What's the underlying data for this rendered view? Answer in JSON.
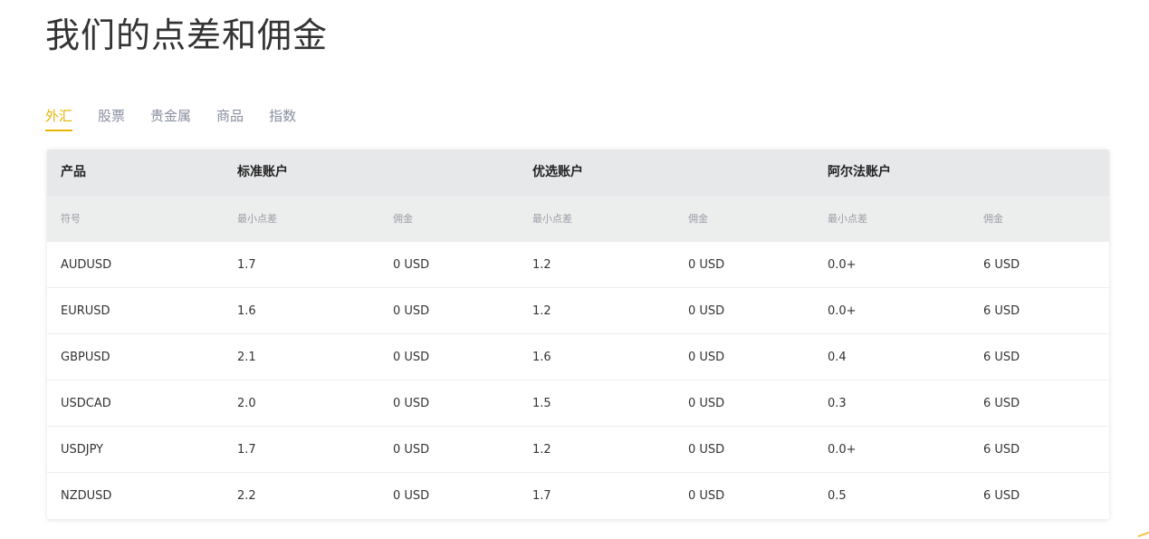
{
  "page_title": "我们的点差和佣金",
  "tabs": [
    {
      "label": "外汇",
      "active": true
    },
    {
      "label": "股票",
      "active": false
    },
    {
      "label": "贵金属",
      "active": false
    },
    {
      "label": "商品",
      "active": false
    },
    {
      "label": "指数",
      "active": false
    }
  ],
  "accent_color": "#e8b400",
  "table": {
    "headers": {
      "product": "产品",
      "standard": "标准账户",
      "preferred": "优选账户",
      "alpha": "阿尔法账户"
    },
    "subheaders": {
      "symbol": "符号",
      "standard_spread": "最小点差",
      "standard_commission": "佣金",
      "preferred_spread": "最小点差",
      "preferred_commission": "佣金",
      "alpha_spread": "最小点差",
      "alpha_commission": "佣金"
    },
    "rows": [
      [
        "AUDUSD",
        "1.7",
        "0 USD",
        "1.2",
        "0 USD",
        "0.0+",
        "6 USD"
      ],
      [
        "EURUSD",
        "1.6",
        "0 USD",
        "1.2",
        "0 USD",
        "0.0+",
        "6 USD"
      ],
      [
        "GBPUSD",
        "2.1",
        "0 USD",
        "1.6",
        "0 USD",
        "0.4",
        "6 USD"
      ],
      [
        "USDCAD",
        "2.0",
        "0 USD",
        "1.5",
        "0 USD",
        "0.3",
        "6 USD"
      ],
      [
        "USDJPY",
        "1.7",
        "0 USD",
        "1.2",
        "0 USD",
        "0.0+",
        "6 USD"
      ],
      [
        "NZDUSD",
        "2.2",
        "0 USD",
        "1.7",
        "0 USD",
        "0.5",
        "6 USD"
      ]
    ]
  }
}
